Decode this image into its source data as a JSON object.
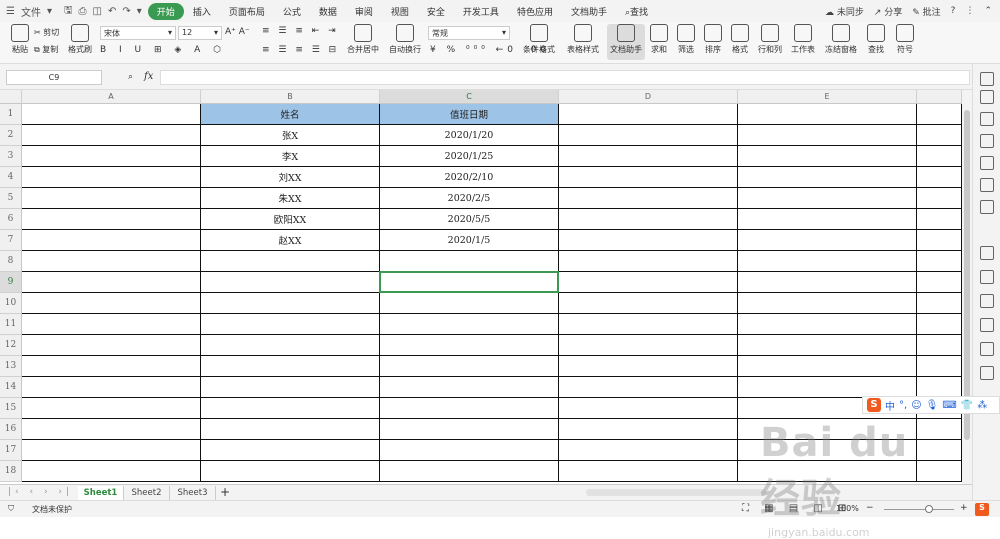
{
  "app": {
    "file_menu": "文件",
    "menu_tabs": [
      "开始",
      "插入",
      "页面布局",
      "公式",
      "数据",
      "审阅",
      "视图",
      "安全",
      "开发工具",
      "特色应用",
      "文档助手"
    ],
    "active_tab": "开始",
    "search": "查找",
    "right_tools": {
      "sync": "未同步",
      "share": "分享",
      "comment": "批注"
    }
  },
  "ribbon": {
    "paste": "粘贴",
    "cut": "剪切",
    "copy": "复制",
    "format_painter": "格式刷",
    "font_name": "宋体",
    "font_size": "12",
    "merge_center": "合并居中",
    "wrap_text": "自动换行",
    "number_format": "常规",
    "conditional_format": "条件格式",
    "table_style": "表格样式",
    "doc_assistant": "文档助手",
    "sum": "求和",
    "filter": "筛选",
    "sort": "排序",
    "format": "格式",
    "row_col": "行和列",
    "worksheet": "工作表",
    "freeze": "冻结窗格",
    "find": "查找",
    "symbol": "符号"
  },
  "formula_bar": {
    "name_box": "C9",
    "fx": "fx",
    "content": ""
  },
  "columns": [
    "A",
    "B",
    "C",
    "D",
    "E"
  ],
  "rows": [
    "1",
    "2",
    "3",
    "4",
    "5",
    "6",
    "7",
    "8",
    "9",
    "10",
    "11",
    "12",
    "13",
    "14",
    "15",
    "16",
    "17",
    "18"
  ],
  "table": {
    "headers": [
      "姓名",
      "值班日期"
    ],
    "rows": [
      [
        "张X",
        "2020/1/20"
      ],
      [
        "李X",
        "2020/1/25"
      ],
      [
        "刘XX",
        "2020/2/10"
      ],
      [
        "朱XX",
        "2020/2/5"
      ],
      [
        "欧阳XX",
        "2020/5/5"
      ],
      [
        "赵XX",
        "2020/1/5"
      ]
    ]
  },
  "sheet_tabs": [
    "Sheet1",
    "Sheet2",
    "Sheet3"
  ],
  "active_sheet": "Sheet1",
  "status": {
    "protect": "文档未保护",
    "zoom": "100%"
  },
  "ime_label": "中",
  "watermark": {
    "brand": "Bai du 经验",
    "url": "jingyan.baidu.com"
  },
  "colors": {
    "accent": "#3a9a52",
    "header_fill": "#9dc3e6"
  }
}
